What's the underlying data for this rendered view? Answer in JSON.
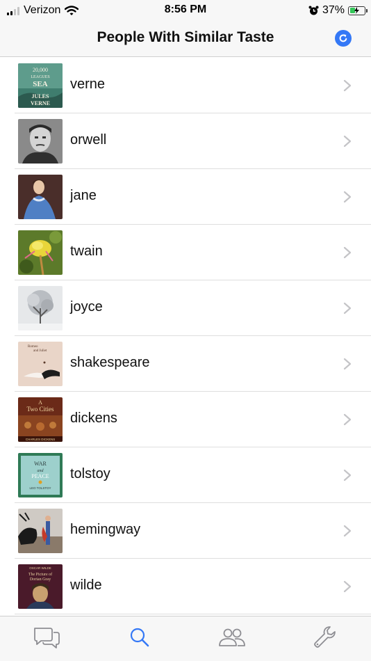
{
  "status_bar": {
    "carrier": "Verizon",
    "time": "8:56 PM",
    "battery_percent": "37%",
    "battery_level": 0.37,
    "icons": [
      "signal-icon",
      "wifi-icon",
      "alarm-icon",
      "battery-charging-icon"
    ]
  },
  "nav": {
    "title": "People With Similar Taste",
    "refresh_icon": "refresh-icon"
  },
  "people": [
    {
      "name": "verne",
      "thumbnail": "twenty-thousand-leagues-cover"
    },
    {
      "name": "orwell",
      "thumbnail": "orwell-portrait"
    },
    {
      "name": "jane",
      "thumbnail": "jane-austen-portrait"
    },
    {
      "name": "twain",
      "thumbnail": "yellow-flower-photo"
    },
    {
      "name": "joyce",
      "thumbnail": "snowy-tree-photo"
    },
    {
      "name": "shakespeare",
      "thumbnail": "romeo-and-juliet-cover"
    },
    {
      "name": "dickens",
      "thumbnail": "tale-of-two-cities-cover"
    },
    {
      "name": "tolstoy",
      "thumbnail": "war-and-peace-cover"
    },
    {
      "name": "hemingway",
      "thumbnail": "bullfight-painting"
    },
    {
      "name": "wilde",
      "thumbnail": "dorian-gray-cover"
    }
  ],
  "thumbnail_text": {
    "verne_top": "20,000 LEAGUES UNDER THE SEA",
    "verne_author": "JULES VERNE",
    "shakespeare_title": "Romeo and Juliet",
    "dickens_title": "A Tale of Two Cities",
    "dickens_author": "CHARLES DICKENS",
    "tolstoy_title": "WAR and PEACE",
    "tolstoy_author": "LEO TOLSTOY",
    "wilde_author": "OSCAR WILDE",
    "wilde_title": "The Picture of Dorian Gray"
  },
  "tabs": [
    {
      "icon": "chat-bubbles-icon",
      "selected": false
    },
    {
      "icon": "search-icon",
      "selected": true
    },
    {
      "icon": "people-icon",
      "selected": false
    },
    {
      "icon": "wrench-icon",
      "selected": false
    }
  ],
  "colors": {
    "accent": "#3478f6",
    "tab_inactive": "#8e8e93",
    "chevron": "#c4c4c7",
    "battery_fill": "#34c759"
  }
}
